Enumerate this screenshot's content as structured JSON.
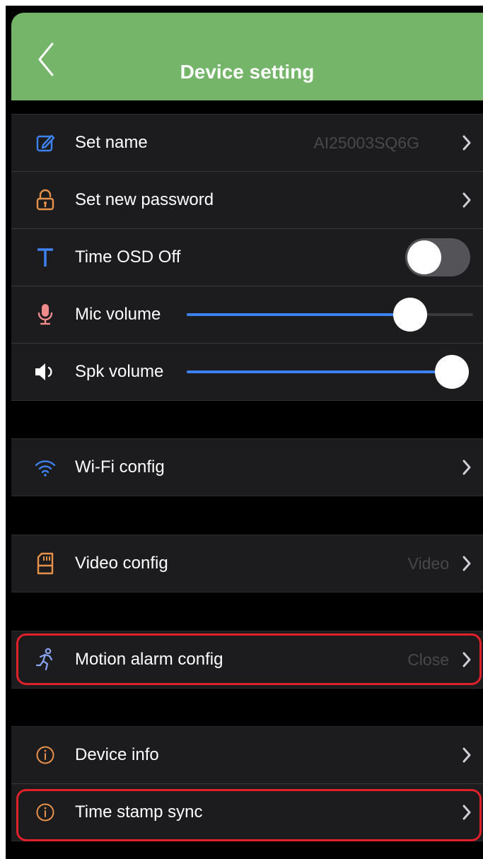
{
  "header": {
    "title": "Device setting"
  },
  "settings": {
    "set_name": {
      "label": "Set name",
      "value": "AI25003SQ6G"
    },
    "set_password": {
      "label": "Set new password"
    },
    "time_osd": {
      "label": "Time OSD Off",
      "toggle_on": false
    },
    "mic_volume": {
      "label": "Mic volume",
      "level": 0.78
    },
    "spk_volume": {
      "label": "Spk volume",
      "level": 1.0
    }
  },
  "wifi": {
    "label": "Wi-Fi config"
  },
  "video": {
    "label": "Video config",
    "value": "Video"
  },
  "motion": {
    "label": "Motion alarm config",
    "value": "Close"
  },
  "info": {
    "device_info": {
      "label": "Device info"
    },
    "time_stamp": {
      "label": "Time stamp sync"
    }
  },
  "colors": {
    "header_bg": "#74b56a",
    "row_bg": "#1c1c1e",
    "accent_blue": "#3d82f0",
    "icon_orange": "#e8914a",
    "highlight_red": "#e0202a"
  },
  "icons": [
    "back-chevron-icon",
    "edit-icon",
    "lock-icon",
    "text-t-icon",
    "microphone-icon",
    "speaker-icon",
    "wifi-icon",
    "sd-card-icon",
    "running-person-icon",
    "info-icon"
  ]
}
